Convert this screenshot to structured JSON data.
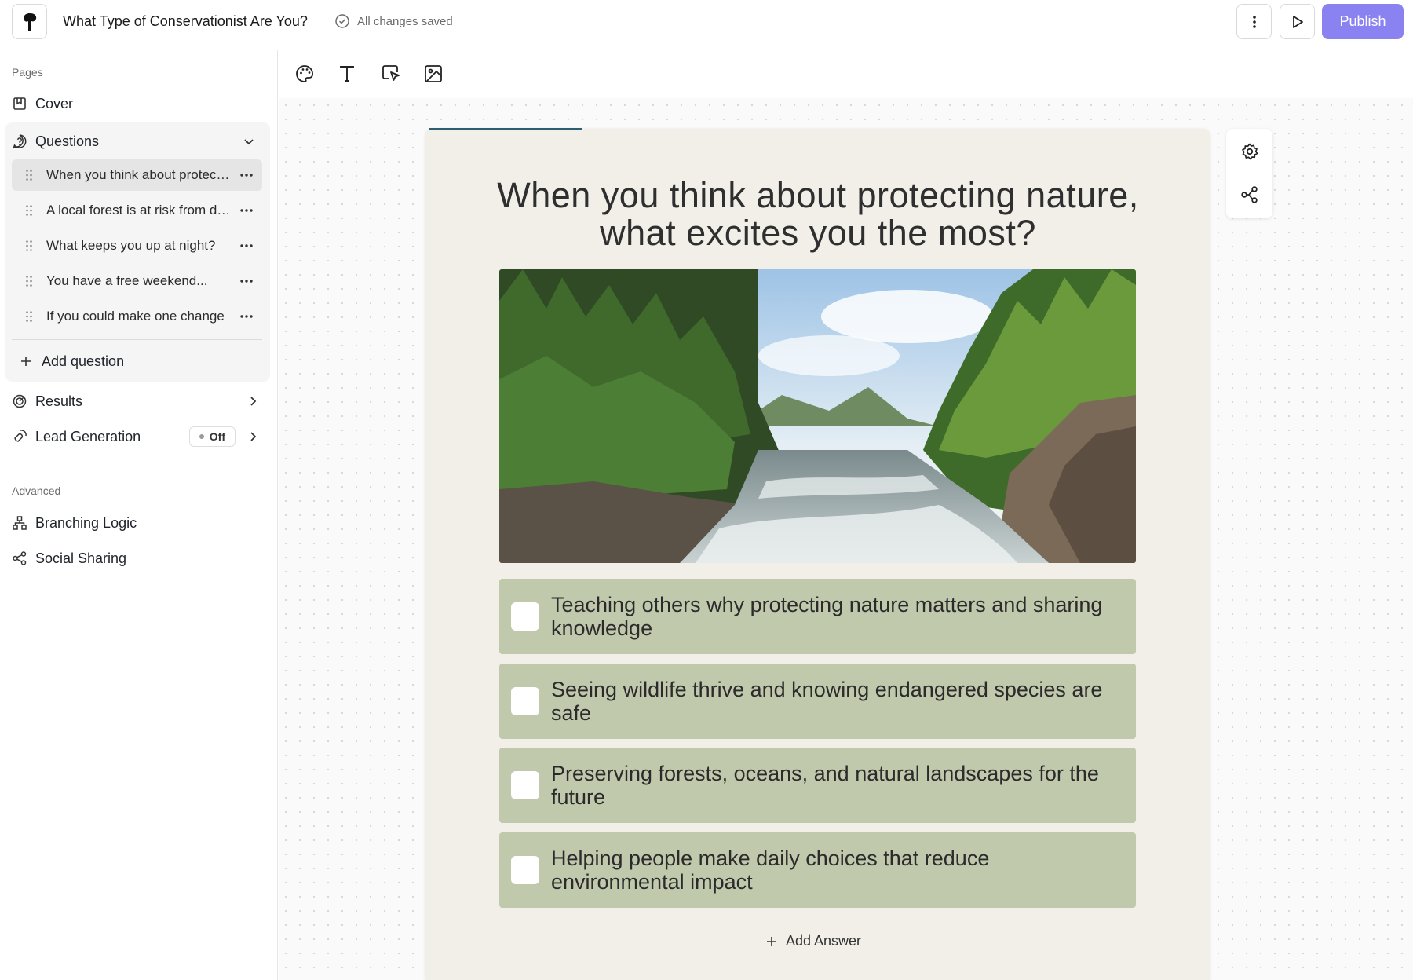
{
  "header": {
    "title": "What Type of Conservationist Are You?",
    "save_status": "All changes saved",
    "publish_label": "Publish",
    "more_icon": "more-vertical-icon",
    "preview_icon": "play-icon"
  },
  "sidebar": {
    "pages_label": "Pages",
    "cover_label": "Cover",
    "questions_label": "Questions",
    "questions": [
      {
        "text": "When you think about protecting nature, what excites you the most?",
        "active": true
      },
      {
        "text": "A local forest is at risk from development"
      },
      {
        "text": "What keeps you up at night?"
      },
      {
        "text": "You have a free weekend..."
      },
      {
        "text": "If you could make one change"
      }
    ],
    "add_question_label": "Add question",
    "results_label": "Results",
    "lead_generation_label": "Lead Generation",
    "lead_generation_status": "Off",
    "advanced_label": "Advanced",
    "branching_logic_label": "Branching Logic",
    "social_sharing_label": "Social Sharing"
  },
  "toolbar": {
    "tools": [
      "palette-icon",
      "text-icon",
      "button-select-icon",
      "image-icon"
    ]
  },
  "question": {
    "title": "When you think about protecting nature, what excites you the most?",
    "image": "forest-river-photo",
    "answers": [
      {
        "text": "Teaching others why protecting nature matters and sharing knowledge"
      },
      {
        "text": "Seeing wildlife thrive and knowing endangered species are safe"
      },
      {
        "text": "Preserving forests, oceans, and natural landscapes for the future"
      },
      {
        "text": "Helping people make daily choices that reduce environmental impact"
      }
    ],
    "add_answer_label": "Add Answer",
    "progress": 0.2
  },
  "side_tools": [
    "settings-icon",
    "branching-icon"
  ],
  "colors": {
    "accent": "#8a82f0",
    "card_bg": "#f1efe8",
    "answer_bg": "#c1c9ad",
    "progress": "#2d5f73"
  }
}
